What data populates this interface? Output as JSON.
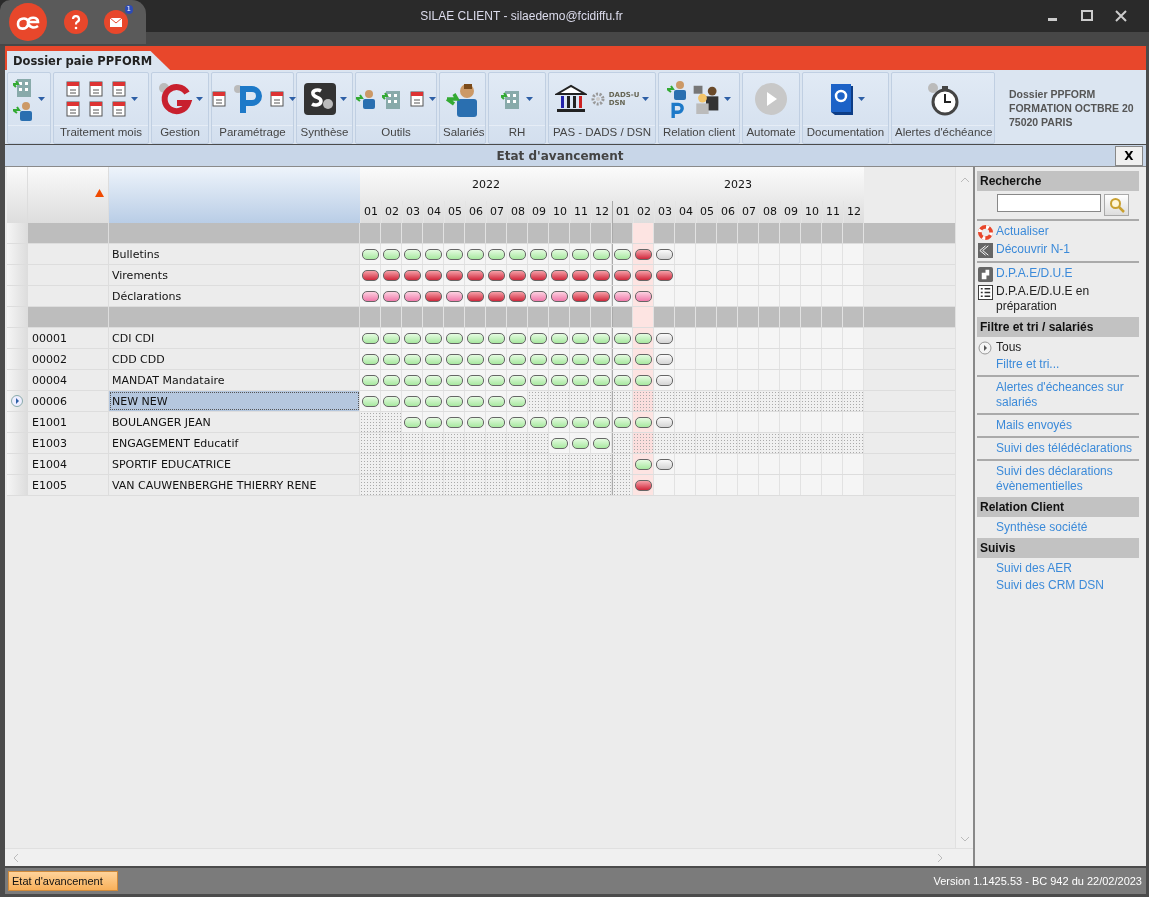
{
  "window": {
    "title": "SILAE CLIENT - silaedemo@fcidiffu.fr",
    "mail_count": "1"
  },
  "document_tab": {
    "label": "Dossier paie PPFORM",
    "selected": true
  },
  "toolbar": {
    "groups": [
      {
        "dropdown": true
      },
      {
        "label": "Traitement mois",
        "dropdown": true
      },
      {
        "label": "Gestion",
        "dropdown": true
      },
      {
        "label": "Paramétrage",
        "dropdown": true
      },
      {
        "label": "Synthèse",
        "dropdown": true
      },
      {
        "label": "Outils",
        "dropdown": true
      },
      {
        "label": "Salariés",
        "dropdown": false
      },
      {
        "label": "RH",
        "dropdown": true
      },
      {
        "label": "PAS - DADS / DSN",
        "dropdown": true,
        "icon_caption": [
          "DADS-U",
          "DSN"
        ]
      },
      {
        "label": "Relation client",
        "dropdown": true
      },
      {
        "label": "Automate",
        "dropdown": false
      },
      {
        "label": "Documentation",
        "dropdown": true
      },
      {
        "label": "Alertes d'échéance",
        "dropdown": false
      }
    ],
    "company": [
      "Dossier PPFORM",
      "FORMATION OCTBRE 20",
      "75020 PARIS"
    ]
  },
  "panel": {
    "title": "Etat d'avancement",
    "close": "X"
  },
  "grid": {
    "years": [
      {
        "label": "2022"
      },
      {
        "label": "2023"
      }
    ],
    "months": [
      {
        "label": "01",
        "current": false
      },
      {
        "label": "02",
        "current": false
      },
      {
        "label": "03",
        "current": false
      },
      {
        "label": "04",
        "current": false
      },
      {
        "label": "05",
        "current": false
      },
      {
        "label": "06",
        "current": false
      },
      {
        "label": "07",
        "current": false
      },
      {
        "label": "08",
        "current": false
      },
      {
        "label": "09",
        "current": false
      },
      {
        "label": "10",
        "current": false
      },
      {
        "label": "11",
        "current": false
      },
      {
        "label": "12",
        "current": false
      },
      {
        "label": "01",
        "current": false
      },
      {
        "label": "02",
        "current": true
      },
      {
        "label": "03",
        "current": false
      },
      {
        "label": "04",
        "current": false
      },
      {
        "label": "05",
        "current": false
      },
      {
        "label": "06",
        "current": false
      },
      {
        "label": "07",
        "current": false
      },
      {
        "label": "08",
        "current": false
      },
      {
        "label": "09",
        "current": false
      },
      {
        "label": "10",
        "current": false
      },
      {
        "label": "11",
        "current": false
      },
      {
        "label": "12",
        "current": false
      }
    ],
    "rows": [
      {
        "kind": "group",
        "selected": false
      },
      {
        "kind": "summary",
        "name": "Bulletins",
        "selected": false,
        "months": [
          {
            "kind": "ok"
          },
          {
            "kind": "ok"
          },
          {
            "kind": "ok"
          },
          {
            "kind": "ok"
          },
          {
            "kind": "ok"
          },
          {
            "kind": "ok"
          },
          {
            "kind": "ok"
          },
          {
            "kind": "ok"
          },
          {
            "kind": "ok"
          },
          {
            "kind": "ok"
          },
          {
            "kind": "ok"
          },
          {
            "kind": "ok"
          },
          {
            "kind": "ok"
          },
          {
            "kind": "error"
          },
          {
            "kind": "pending"
          },
          {
            "kind": "empty"
          },
          {
            "kind": "empty"
          },
          {
            "kind": "empty"
          },
          {
            "kind": "empty"
          },
          {
            "kind": "empty"
          },
          {
            "kind": "empty"
          },
          {
            "kind": "empty"
          },
          {
            "kind": "empty"
          },
          {
            "kind": "empty"
          }
        ]
      },
      {
        "kind": "summary",
        "name": "Virements",
        "selected": false,
        "months": [
          {
            "kind": "error"
          },
          {
            "kind": "error"
          },
          {
            "kind": "error"
          },
          {
            "kind": "error"
          },
          {
            "kind": "error"
          },
          {
            "kind": "error"
          },
          {
            "kind": "error"
          },
          {
            "kind": "error"
          },
          {
            "kind": "error"
          },
          {
            "kind": "error"
          },
          {
            "kind": "error"
          },
          {
            "kind": "error"
          },
          {
            "kind": "error"
          },
          {
            "kind": "error"
          },
          {
            "kind": "error"
          },
          {
            "kind": "empty"
          },
          {
            "kind": "empty"
          },
          {
            "kind": "empty"
          },
          {
            "kind": "empty"
          },
          {
            "kind": "empty"
          },
          {
            "kind": "empty"
          },
          {
            "kind": "empty"
          },
          {
            "kind": "empty"
          },
          {
            "kind": "empty"
          }
        ]
      },
      {
        "kind": "summary",
        "name": "Déclarations",
        "selected": false,
        "months": [
          {
            "kind": "partial"
          },
          {
            "kind": "partial"
          },
          {
            "kind": "partial"
          },
          {
            "kind": "error"
          },
          {
            "kind": "partial"
          },
          {
            "kind": "error"
          },
          {
            "kind": "error"
          },
          {
            "kind": "error"
          },
          {
            "kind": "partial"
          },
          {
            "kind": "partial"
          },
          {
            "kind": "error"
          },
          {
            "kind": "error"
          },
          {
            "kind": "partial"
          },
          {
            "kind": "partial"
          },
          {
            "kind": "empty"
          },
          {
            "kind": "empty"
          },
          {
            "kind": "empty"
          },
          {
            "kind": "empty"
          },
          {
            "kind": "empty"
          },
          {
            "kind": "empty"
          },
          {
            "kind": "empty"
          },
          {
            "kind": "empty"
          },
          {
            "kind": "empty"
          },
          {
            "kind": "empty"
          }
        ]
      },
      {
        "kind": "group",
        "selected": false
      },
      {
        "kind": "employee",
        "code": "00001",
        "name": "CDI CDI",
        "selected": false,
        "months": [
          {
            "kind": "ok"
          },
          {
            "kind": "ok"
          },
          {
            "kind": "ok"
          },
          {
            "kind": "ok"
          },
          {
            "kind": "ok"
          },
          {
            "kind": "ok"
          },
          {
            "kind": "ok"
          },
          {
            "kind": "ok"
          },
          {
            "kind": "ok"
          },
          {
            "kind": "ok"
          },
          {
            "kind": "ok"
          },
          {
            "kind": "ok"
          },
          {
            "kind": "ok"
          },
          {
            "kind": "ok"
          },
          {
            "kind": "pending"
          },
          {
            "kind": "empty"
          },
          {
            "kind": "empty"
          },
          {
            "kind": "empty"
          },
          {
            "kind": "empty"
          },
          {
            "kind": "empty"
          },
          {
            "kind": "empty"
          },
          {
            "kind": "empty"
          },
          {
            "kind": "empty"
          },
          {
            "kind": "empty"
          }
        ]
      },
      {
        "kind": "employee",
        "code": "00002",
        "name": "CDD CDD",
        "selected": false,
        "months": [
          {
            "kind": "ok"
          },
          {
            "kind": "ok"
          },
          {
            "kind": "ok"
          },
          {
            "kind": "ok"
          },
          {
            "kind": "ok"
          },
          {
            "kind": "ok"
          },
          {
            "kind": "ok"
          },
          {
            "kind": "ok"
          },
          {
            "kind": "ok"
          },
          {
            "kind": "ok"
          },
          {
            "kind": "ok"
          },
          {
            "kind": "ok"
          },
          {
            "kind": "ok"
          },
          {
            "kind": "ok"
          },
          {
            "kind": "pending"
          },
          {
            "kind": "empty"
          },
          {
            "kind": "empty"
          },
          {
            "kind": "empty"
          },
          {
            "kind": "empty"
          },
          {
            "kind": "empty"
          },
          {
            "kind": "empty"
          },
          {
            "kind": "empty"
          },
          {
            "kind": "empty"
          },
          {
            "kind": "empty"
          }
        ]
      },
      {
        "kind": "employee",
        "code": "00004",
        "name": "MANDAT Mandataire",
        "selected": false,
        "months": [
          {
            "kind": "ok"
          },
          {
            "kind": "ok"
          },
          {
            "kind": "ok"
          },
          {
            "kind": "ok"
          },
          {
            "kind": "ok"
          },
          {
            "kind": "ok"
          },
          {
            "kind": "ok"
          },
          {
            "kind": "ok"
          },
          {
            "kind": "ok"
          },
          {
            "kind": "ok"
          },
          {
            "kind": "ok"
          },
          {
            "kind": "ok"
          },
          {
            "kind": "ok"
          },
          {
            "kind": "ok"
          },
          {
            "kind": "pending"
          },
          {
            "kind": "empty"
          },
          {
            "kind": "empty"
          },
          {
            "kind": "empty"
          },
          {
            "kind": "empty"
          },
          {
            "kind": "empty"
          },
          {
            "kind": "empty"
          },
          {
            "kind": "empty"
          },
          {
            "kind": "empty"
          },
          {
            "kind": "empty"
          }
        ]
      },
      {
        "kind": "employee",
        "code": "00006",
        "name": "NEW NEW",
        "selected": true,
        "months": [
          {
            "kind": "ok"
          },
          {
            "kind": "ok"
          },
          {
            "kind": "ok"
          },
          {
            "kind": "ok"
          },
          {
            "kind": "ok"
          },
          {
            "kind": "ok"
          },
          {
            "kind": "ok"
          },
          {
            "kind": "ok"
          },
          {
            "kind": "inactive"
          },
          {
            "kind": "inactive"
          },
          {
            "kind": "inactive"
          },
          {
            "kind": "inactive"
          },
          {
            "kind": "inactive"
          },
          {
            "kind": "inactive"
          },
          {
            "kind": "inactive"
          },
          {
            "kind": "inactive"
          },
          {
            "kind": "inactive"
          },
          {
            "kind": "inactive"
          },
          {
            "kind": "inactive"
          },
          {
            "kind": "inactive"
          },
          {
            "kind": "inactive"
          },
          {
            "kind": "inactive"
          },
          {
            "kind": "inactive"
          },
          {
            "kind": "inactive"
          }
        ]
      },
      {
        "kind": "employee",
        "code": "E1001",
        "name": "BOULANGER JEAN",
        "selected": false,
        "months": [
          {
            "kind": "inactive"
          },
          {
            "kind": "inactive"
          },
          {
            "kind": "ok"
          },
          {
            "kind": "ok"
          },
          {
            "kind": "ok"
          },
          {
            "kind": "ok"
          },
          {
            "kind": "ok"
          },
          {
            "kind": "ok"
          },
          {
            "kind": "ok"
          },
          {
            "kind": "ok"
          },
          {
            "kind": "ok"
          },
          {
            "kind": "ok"
          },
          {
            "kind": "ok"
          },
          {
            "kind": "ok"
          },
          {
            "kind": "pending"
          },
          {
            "kind": "empty"
          },
          {
            "kind": "empty"
          },
          {
            "kind": "empty"
          },
          {
            "kind": "empty"
          },
          {
            "kind": "empty"
          },
          {
            "kind": "empty"
          },
          {
            "kind": "empty"
          },
          {
            "kind": "empty"
          },
          {
            "kind": "empty"
          }
        ]
      },
      {
        "kind": "employee",
        "code": "E1003",
        "name": "ENGAGEMENT Educatif",
        "selected": false,
        "months": [
          {
            "kind": "inactive"
          },
          {
            "kind": "inactive"
          },
          {
            "kind": "inactive"
          },
          {
            "kind": "inactive"
          },
          {
            "kind": "inactive"
          },
          {
            "kind": "inactive"
          },
          {
            "kind": "inactive"
          },
          {
            "kind": "inactive"
          },
          {
            "kind": "inactive"
          },
          {
            "kind": "ok"
          },
          {
            "kind": "ok"
          },
          {
            "kind": "ok"
          },
          {
            "kind": "inactive"
          },
          {
            "kind": "inactive"
          },
          {
            "kind": "inactive"
          },
          {
            "kind": "inactive"
          },
          {
            "kind": "inactive"
          },
          {
            "kind": "inactive"
          },
          {
            "kind": "inactive"
          },
          {
            "kind": "inactive"
          },
          {
            "kind": "inactive"
          },
          {
            "kind": "inactive"
          },
          {
            "kind": "inactive"
          },
          {
            "kind": "inactive"
          }
        ]
      },
      {
        "kind": "employee",
        "code": "E1004",
        "name": "SPORTIF EDUCATRICE",
        "selected": false,
        "months": [
          {
            "kind": "inactive"
          },
          {
            "kind": "inactive"
          },
          {
            "kind": "inactive"
          },
          {
            "kind": "inactive"
          },
          {
            "kind": "inactive"
          },
          {
            "kind": "inactive"
          },
          {
            "kind": "inactive"
          },
          {
            "kind": "inactive"
          },
          {
            "kind": "inactive"
          },
          {
            "kind": "inactive"
          },
          {
            "kind": "inactive"
          },
          {
            "kind": "inactive"
          },
          {
            "kind": "inactive"
          },
          {
            "kind": "ok"
          },
          {
            "kind": "pending"
          },
          {
            "kind": "empty"
          },
          {
            "kind": "empty"
          },
          {
            "kind": "empty"
          },
          {
            "kind": "empty"
          },
          {
            "kind": "empty"
          },
          {
            "kind": "empty"
          },
          {
            "kind": "empty"
          },
          {
            "kind": "empty"
          },
          {
            "kind": "empty"
          }
        ]
      },
      {
        "kind": "employee",
        "code": "E1005",
        "name": "VAN CAUWENBERGHE THIERRY RENE",
        "selected": false,
        "months": [
          {
            "kind": "inactive"
          },
          {
            "kind": "inactive"
          },
          {
            "kind": "inactive"
          },
          {
            "kind": "inactive"
          },
          {
            "kind": "inactive"
          },
          {
            "kind": "inactive"
          },
          {
            "kind": "inactive"
          },
          {
            "kind": "inactive"
          },
          {
            "kind": "inactive"
          },
          {
            "kind": "inactive"
          },
          {
            "kind": "inactive"
          },
          {
            "kind": "inactive"
          },
          {
            "kind": "inactive"
          },
          {
            "kind": "error"
          },
          {
            "kind": "empty"
          },
          {
            "kind": "empty"
          },
          {
            "kind": "empty"
          },
          {
            "kind": "empty"
          },
          {
            "kind": "empty"
          },
          {
            "kind": "empty"
          },
          {
            "kind": "empty"
          },
          {
            "kind": "empty"
          },
          {
            "kind": "empty"
          },
          {
            "kind": "empty"
          }
        ]
      }
    ]
  },
  "sidebar": {
    "sections": [
      {
        "title": "Recherche",
        "search": true,
        "groups": [
          [
            {
              "label": "Actualiser",
              "kind": "link"
            },
            {
              "label": "Découvrir N-1",
              "kind": "link"
            }
          ],
          [
            {
              "label": "D.P.A.E/D.U.E",
              "kind": "link"
            },
            {
              "label": "D.P.A.E/D.U.E en préparation",
              "kind": "text"
            }
          ]
        ]
      },
      {
        "title": "Filtre et tri / salariés",
        "groups": [
          [
            {
              "label": "Tous",
              "kind": "radio"
            },
            {
              "label": "Filtre et tri...",
              "kind": "link"
            }
          ],
          [
            {
              "label": "Alertes d'écheances sur salariés",
              "kind": "link"
            }
          ],
          [
            {
              "label": "Mails envoyés",
              "kind": "link"
            }
          ],
          [
            {
              "label": "Suivi des télédéclarations",
              "kind": "link"
            }
          ],
          [
            {
              "label": "Suivi des déclarations évènementielles",
              "kind": "link"
            }
          ]
        ]
      },
      {
        "title": "Relation Client",
        "groups": [
          [
            {
              "label": "Synthèse société",
              "kind": "link"
            }
          ]
        ]
      },
      {
        "title": "Suivis",
        "groups": [
          [
            {
              "label": "Suivi des AER",
              "kind": "link"
            },
            {
              "label": "Suivi des CRM DSN",
              "kind": "link"
            }
          ]
        ]
      }
    ]
  },
  "status_bar": {
    "tab": "Etat d'avancement",
    "version": "Version 1.1425.53 - BC 942 du 22/02/2023"
  }
}
